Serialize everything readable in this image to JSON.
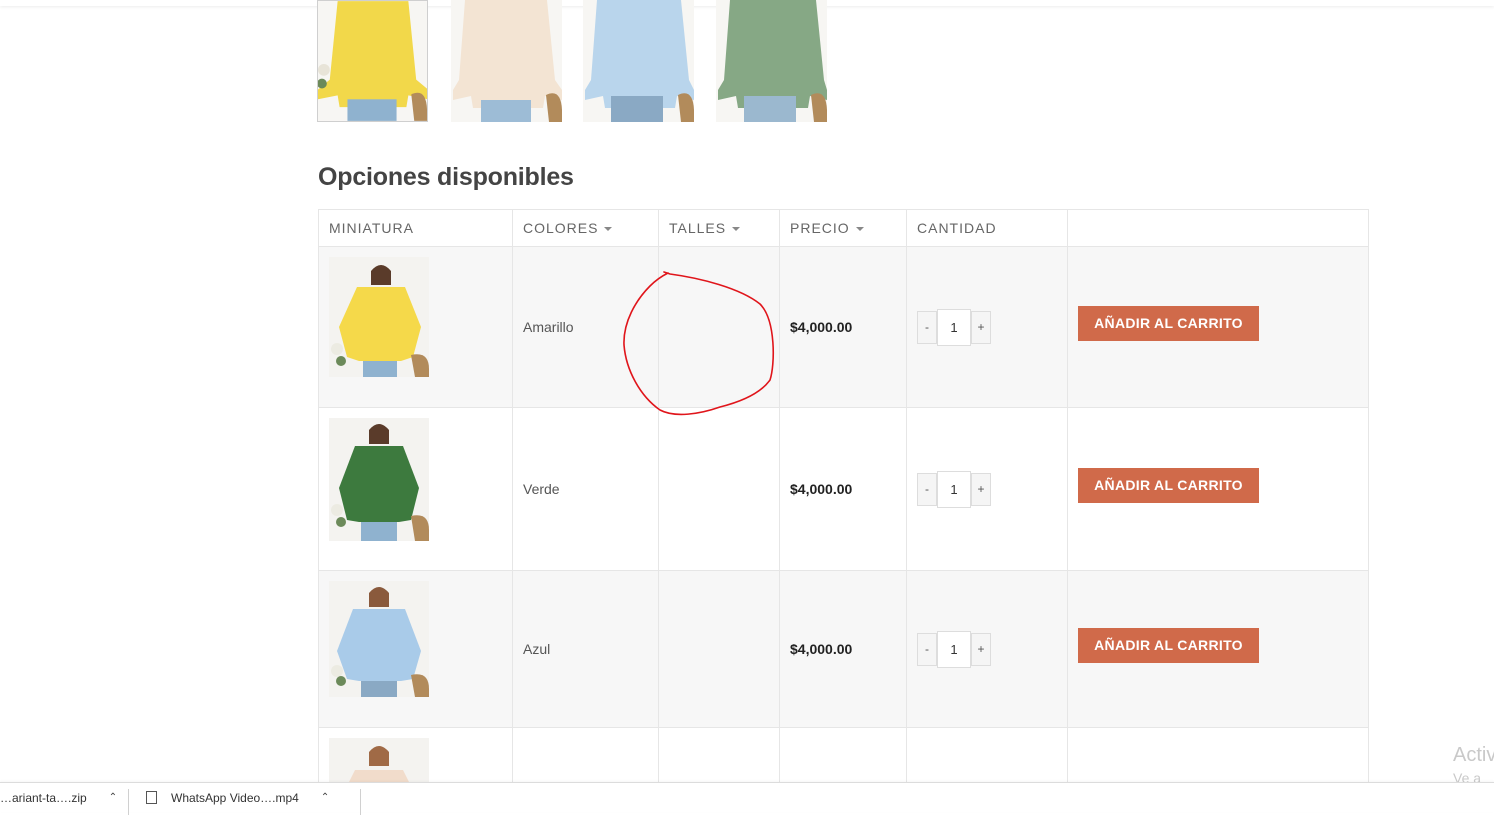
{
  "gallery": [
    {
      "color": "#f2d84a",
      "alt": "amarillo"
    },
    {
      "color": "#f3e4d3",
      "alt": "beige"
    },
    {
      "color": "#b9d5ec",
      "alt": "azul"
    },
    {
      "color": "#86a885",
      "alt": "verde"
    }
  ],
  "section_title": "Opciones disponibles",
  "table": {
    "headers": {
      "miniatura": "MINIATURA",
      "colores": "COLORES",
      "talles": "TALLES",
      "precio": "PRECIO",
      "cantidad": "CANTIDAD"
    },
    "rows": [
      {
        "color_name": "Amarillo",
        "talle": "",
        "price": "$4,000.00",
        "qty": "1",
        "minus": "-",
        "plus": "+",
        "add_label": "AÑADIR AL CARRITO",
        "sweater": "#f5d94a"
      },
      {
        "color_name": "Verde",
        "talle": "",
        "price": "$4,000.00",
        "qty": "1",
        "minus": "-",
        "plus": "+",
        "add_label": "AÑADIR AL CARRITO",
        "sweater": "#3d7a3e"
      },
      {
        "color_name": "Azul",
        "talle": "",
        "price": "$4,000.00",
        "qty": "1",
        "minus": "-",
        "plus": "+",
        "add_label": "AÑADIR AL CARRITO",
        "sweater": "#a9cbe9"
      },
      {
        "color_name": "",
        "talle": "",
        "price": "",
        "qty": "",
        "sweater": "#f1dccb"
      }
    ]
  },
  "colors": {
    "accent": "#d06a4a",
    "annotation": "#e0151b"
  },
  "watermark": {
    "line1": "Activ",
    "line2": "Ve a C"
  },
  "downloads": [
    {
      "name": "…ariant-ta….zip"
    },
    {
      "name": "WhatsApp Video….mp4"
    }
  ]
}
